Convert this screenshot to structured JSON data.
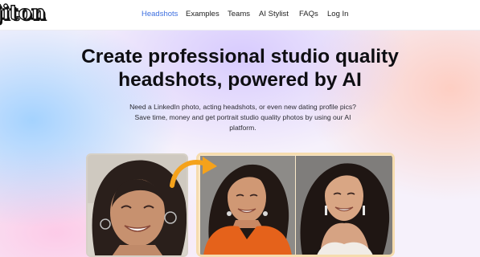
{
  "brand": {
    "logo_text": "jiton"
  },
  "nav": {
    "items": [
      {
        "label": "Headshots",
        "active": true
      },
      {
        "label": "Examples"
      },
      {
        "label": "Teams"
      },
      {
        "label": "AI Stylist"
      },
      {
        "label": "FAQs"
      },
      {
        "label": "Log In"
      }
    ]
  },
  "hero": {
    "title_line1": "Create professional studio quality",
    "title_line2": "headshots, powered by AI",
    "subtitle_line1": "Need a LinkedIn photo, acting headshots, or even new dating profile pics?",
    "subtitle_line2": "Save time, money and get portrait studio quality photos by using our AI",
    "subtitle_line3": "platform."
  },
  "colors": {
    "nav_active": "#3d6fe0",
    "arrow": "#f5a21b",
    "after_card_border": "#f6dcae"
  },
  "icons": {
    "arrow": "curved-arrow-icon"
  }
}
